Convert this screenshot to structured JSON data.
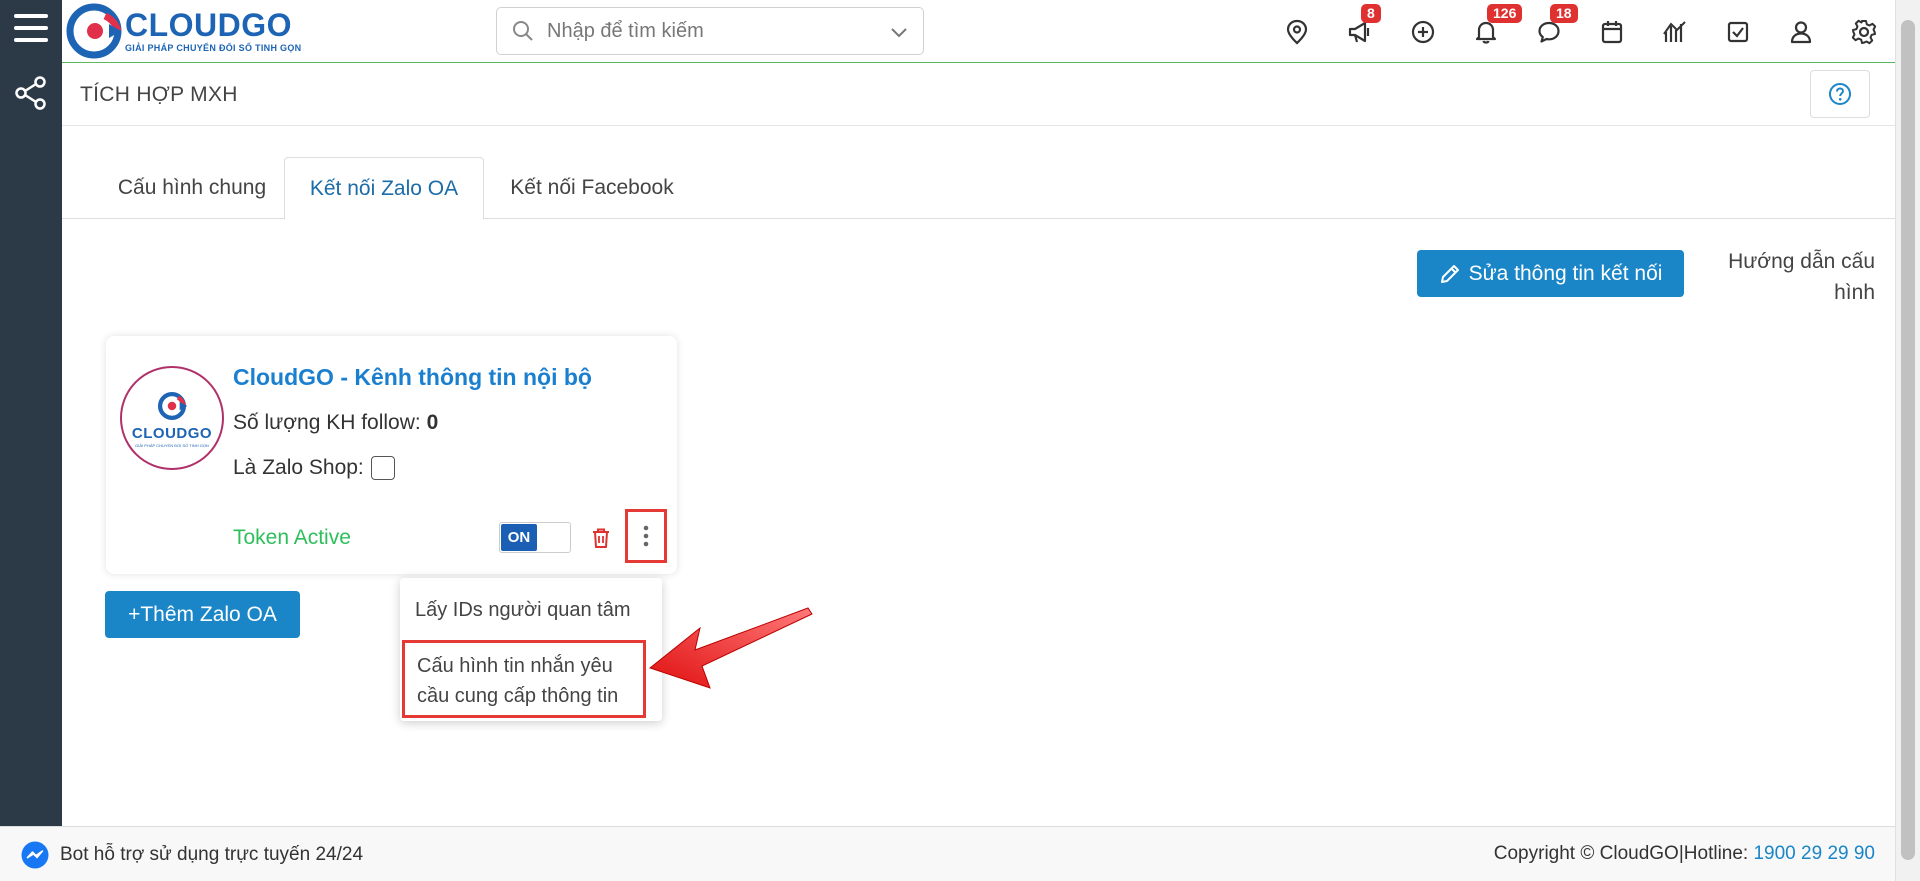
{
  "sidebar": {
    "menu_icon": "hamburger-icon",
    "share_icon": "share-icon"
  },
  "header": {
    "logo_brand": "CLOUDGO",
    "logo_tagline": "GIẢI PHÁP CHUYỂN ĐỔI SỐ TINH GỌN",
    "search_placeholder": "Nhập để tìm kiếm",
    "icons": [
      {
        "name": "location-icon"
      },
      {
        "name": "megaphone-icon",
        "badge": "8"
      },
      {
        "name": "add-circle-icon"
      },
      {
        "name": "bell-icon",
        "badge": "126"
      },
      {
        "name": "chat-icon",
        "badge": "18"
      },
      {
        "name": "calendar-icon"
      },
      {
        "name": "chart-icon"
      },
      {
        "name": "task-icon"
      },
      {
        "name": "user-icon"
      },
      {
        "name": "gear-icon"
      }
    ],
    "badge_color": "#e03131"
  },
  "page": {
    "title": "TÍCH HỢP MXH"
  },
  "tabs": [
    {
      "label": "Cấu hình chung",
      "active": false
    },
    {
      "label": "Kết nối Zalo OA",
      "active": true
    },
    {
      "label": "Kết nối Facebook",
      "active": false
    }
  ],
  "actions": {
    "edit_label": "Sửa thông tin kết nối",
    "guide_label": "Hướng dẫn cấu hình",
    "add_label": "+Thêm Zalo OA"
  },
  "oa_card": {
    "avatar_brand": "CLOUDGO",
    "avatar_tagline": "GIẢI PHÁP CHUYỂN ĐỔI SỐ TINH GỌN",
    "name": "CloudGO - Kênh thông tin nội bộ",
    "follow_label": "Số lượng KH follow:",
    "follow_count": "0",
    "zalo_shop_label": "Là Zalo Shop:",
    "zalo_shop_checked": false,
    "token_status": "Token Active",
    "toggle_label": "ON",
    "toggle_on": true
  },
  "menu": {
    "items": [
      {
        "label": "Lấy IDs người quan tâm"
      },
      {
        "label": "Cấu hình tin nhắn yêu cầu cung cấp thông tin"
      }
    ]
  },
  "footer": {
    "bot_text": "Bot hỗ trợ sử dụng trực tuyến 24/24",
    "copyright": "Copyright © CloudGO|Hotline:",
    "hotline": "1900 29 29 90"
  },
  "colors": {
    "primary": "#1a86c8",
    "sidebar": "#2c3a47",
    "active_tab": "#1b6ca8",
    "token_active": "#2ebf5c",
    "highlight": "#e53935"
  }
}
